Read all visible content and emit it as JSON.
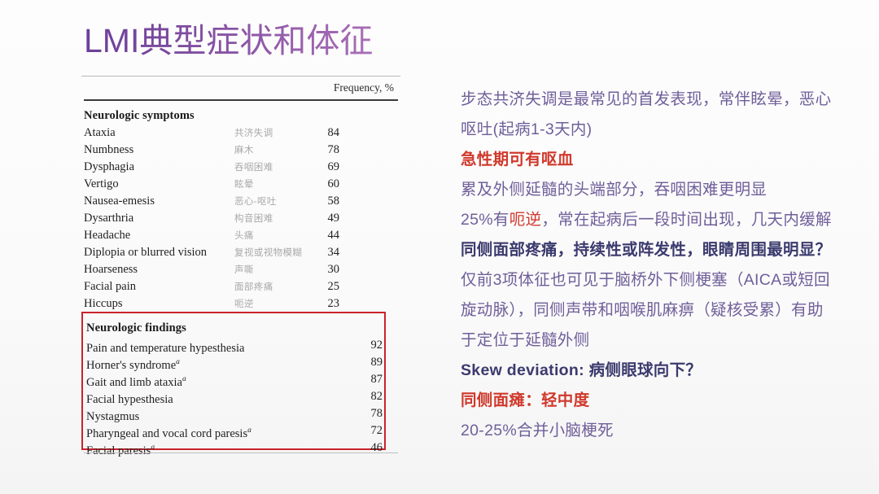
{
  "slide": {
    "title": "LMI典型症状和体征",
    "background_color": "#f6f6f6",
    "title_gradient_from": "#6b3f99",
    "title_gradient_to": "#a86fb4"
  },
  "table": {
    "frequency_header": "Frequency, %",
    "sections": [
      {
        "heading": "Neurologic symptoms",
        "rows": [
          {
            "en": "Ataxia",
            "cn": "共济失调",
            "value": "84"
          },
          {
            "en": "Numbness",
            "cn": "麻木",
            "value": "78"
          },
          {
            "en": "Dysphagia",
            "cn": "吞咽困难",
            "value": "69"
          },
          {
            "en": "Vertigo",
            "cn": "眩晕",
            "value": "60"
          },
          {
            "en": "Nausea-emesis",
            "cn": "恶心-呕吐",
            "value": "58"
          },
          {
            "en": "Dysarthria",
            "cn": "构音困难",
            "value": "49"
          },
          {
            "en": "Headache",
            "cn": "头痛",
            "value": "44"
          },
          {
            "en": "Diplopia or blurred vision",
            "cn": "复视或视物模糊",
            "value": "34"
          },
          {
            "en": "Hoarseness",
            "cn": "声嘶",
            "value": "30"
          },
          {
            "en": "Facial pain",
            "cn": "面部疼痛",
            "value": "25"
          },
          {
            "en": "Hiccups",
            "cn": "呃逆",
            "value": "23"
          }
        ]
      },
      {
        "heading": "Neurologic findings",
        "highlight_color": "#c9232b",
        "rows": [
          {
            "en": "Pain and temperature hypesthesia",
            "sup": "",
            "value": "92"
          },
          {
            "en": "Horner's syndrome",
            "sup": "a",
            "value": "89"
          },
          {
            "en": "Gait and limb ataxia",
            "sup": "a",
            "value": "87"
          },
          {
            "en": "Facial hypesthesia",
            "sup": "",
            "value": "82"
          },
          {
            "en": "Nystagmus",
            "sup": "",
            "value": "78"
          },
          {
            "en": "Pharyngeal and vocal cord paresis",
            "sup": "a",
            "value": "72"
          },
          {
            "en": "Facial paresis",
            "sup": "a",
            "value": "46"
          }
        ]
      }
    ]
  },
  "notes": {
    "lines": [
      {
        "id": "l1",
        "text": "步态共济失调是最常见的首发表现，常伴眩晕，恶心",
        "style": "purple"
      },
      {
        "id": "l2",
        "text": "呕吐(起病1-3天内)",
        "style": "purple"
      },
      {
        "id": "l3",
        "text": "急性期可有呕血",
        "style": "red"
      },
      {
        "id": "l4",
        "text": "累及外侧延髓的头端部分，吞咽困难更明显",
        "style": "purple"
      },
      {
        "id": "l5a",
        "text": "25%有",
        "style": "purple"
      },
      {
        "id": "l5b",
        "text": "呃逆",
        "style": "red-inline"
      },
      {
        "id": "l5c",
        "text": "，常在起病后一段时间出现，几天内缓解",
        "style": "purple"
      },
      {
        "id": "l6",
        "text": "同侧面部疼痛，持续性或阵发性，眼睛周围最明显？",
        "style": "navy"
      },
      {
        "id": "l7",
        "text": "仅前3项体征也可见于脑桥外下侧梗塞（AICA或短回",
        "style": "purple"
      },
      {
        "id": "l8",
        "text": "旋动脉），同侧声带和咽喉肌麻痹（疑核受累）有助",
        "style": "purple"
      },
      {
        "id": "l9",
        "text": "于定位于延髓外侧",
        "style": "purple"
      },
      {
        "id": "l10",
        "text": "Skew deviation: 病侧眼球向下？",
        "style": "navy"
      },
      {
        "id": "l11",
        "text": "同侧面瘫：轻中度",
        "style": "red"
      },
      {
        "id": "l12",
        "text": "20-25%合并小脑梗死",
        "style": "purple"
      }
    ]
  }
}
